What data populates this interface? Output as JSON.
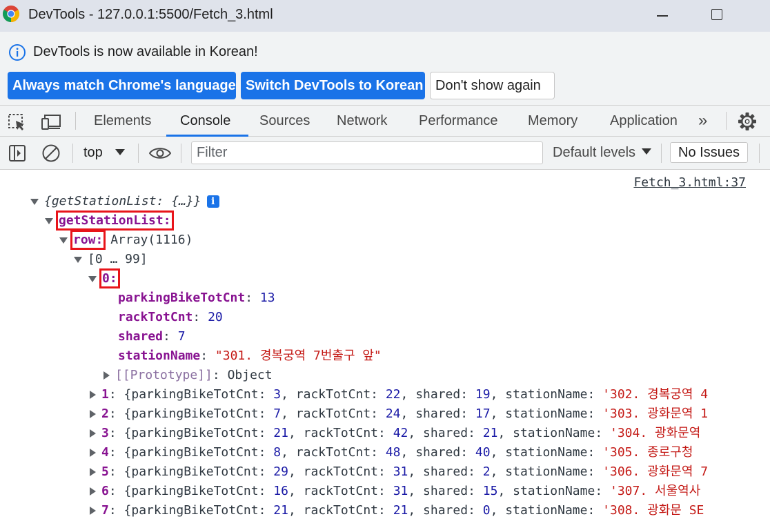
{
  "window": {
    "title": "DevTools - 127.0.0.1:5500/Fetch_3.html"
  },
  "infobar": {
    "message": "DevTools is now available in Korean!",
    "buttons": {
      "match": "Always match Chrome's language",
      "switch": "Switch DevTools to Korean",
      "dont_show": "Don't show again"
    }
  },
  "tabs": {
    "items": [
      "Elements",
      "Console",
      "Sources",
      "Network",
      "Performance",
      "Memory",
      "Application"
    ],
    "active": "Console",
    "more": "»"
  },
  "console_toolbar": {
    "context": "top",
    "filter_placeholder": "Filter",
    "levels": "Default levels",
    "issues": "No Issues"
  },
  "console": {
    "source": "Fetch_3.html:37",
    "root": {
      "key": "getStationList",
      "preview": "{…}",
      "info": "i"
    },
    "getStationList_key": "getStationList",
    "row_key": "row",
    "row_value": "Array(1116)",
    "range": "[0 … 99]",
    "item0_key": "0",
    "item0_props": [
      {
        "key": "parkingBikeTotCnt",
        "value": "13",
        "kind": "num"
      },
      {
        "key": "rackTotCnt",
        "value": "20",
        "kind": "num"
      },
      {
        "key": "shared",
        "value": "7",
        "kind": "num"
      },
      {
        "key": "stationName",
        "value": "\"301. 경복궁역 7번출구 앞\"",
        "kind": "str"
      }
    ],
    "prototype": {
      "key": "[[Prototype]]",
      "value": "Object"
    },
    "rows": [
      {
        "idx": "1",
        "p": "3",
        "r": "22",
        "s": "19",
        "name": "'302. 경복궁역 4"
      },
      {
        "idx": "2",
        "p": "7",
        "r": "24",
        "s": "17",
        "name": "'303. 광화문역 1"
      },
      {
        "idx": "3",
        "p": "21",
        "r": "42",
        "s": "21",
        "name": "'304. 광화문역"
      },
      {
        "idx": "4",
        "p": "8",
        "r": "48",
        "s": "40",
        "name": "'305. 종로구청"
      },
      {
        "idx": "5",
        "p": "29",
        "r": "31",
        "s": "2",
        "name": "'306. 광화문역 7"
      },
      {
        "idx": "6",
        "p": "16",
        "r": "31",
        "s": "15",
        "name": "'307. 서울역사"
      },
      {
        "idx": "7",
        "p": "21",
        "r": "21",
        "s": "0",
        "name": "'308. 광화문 SE"
      }
    ],
    "row_prop_names": {
      "p": "parkingBikeTotCnt",
      "r": "rackTotCnt",
      "s": "shared",
      "n": "stationName"
    }
  },
  "colors": {
    "accent": "#1a73e8",
    "highlight_box": "#e8141a",
    "key_purple": "#881391",
    "number_blue": "#1a1aa6",
    "string_red": "#c41a16"
  }
}
